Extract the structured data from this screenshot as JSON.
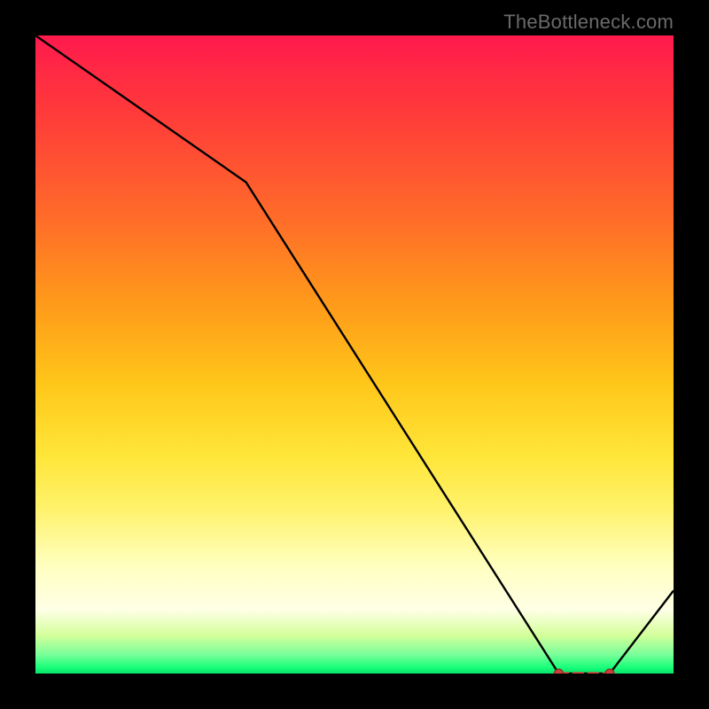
{
  "watermark": "TheBottleneck.com",
  "chart_data": {
    "type": "line",
    "title": "",
    "xlabel": "",
    "ylabel": "",
    "xlim": [
      0,
      100
    ],
    "ylim": [
      0,
      100
    ],
    "grid": false,
    "series": [
      {
        "name": "bottleneck-curve",
        "x": [
          0,
          33,
          82,
          90,
          100
        ],
        "y": [
          100,
          77,
          0,
          0,
          13
        ]
      }
    ],
    "highlight_segment": {
      "x": [
        82,
        90
      ],
      "y": [
        0,
        0
      ]
    },
    "colors": {
      "line": "#000000",
      "highlight": "#c8443a",
      "gradient_top": "#ff1a4d",
      "gradient_mid": "#ffe63a",
      "gradient_bottom": "#06e26a"
    }
  }
}
